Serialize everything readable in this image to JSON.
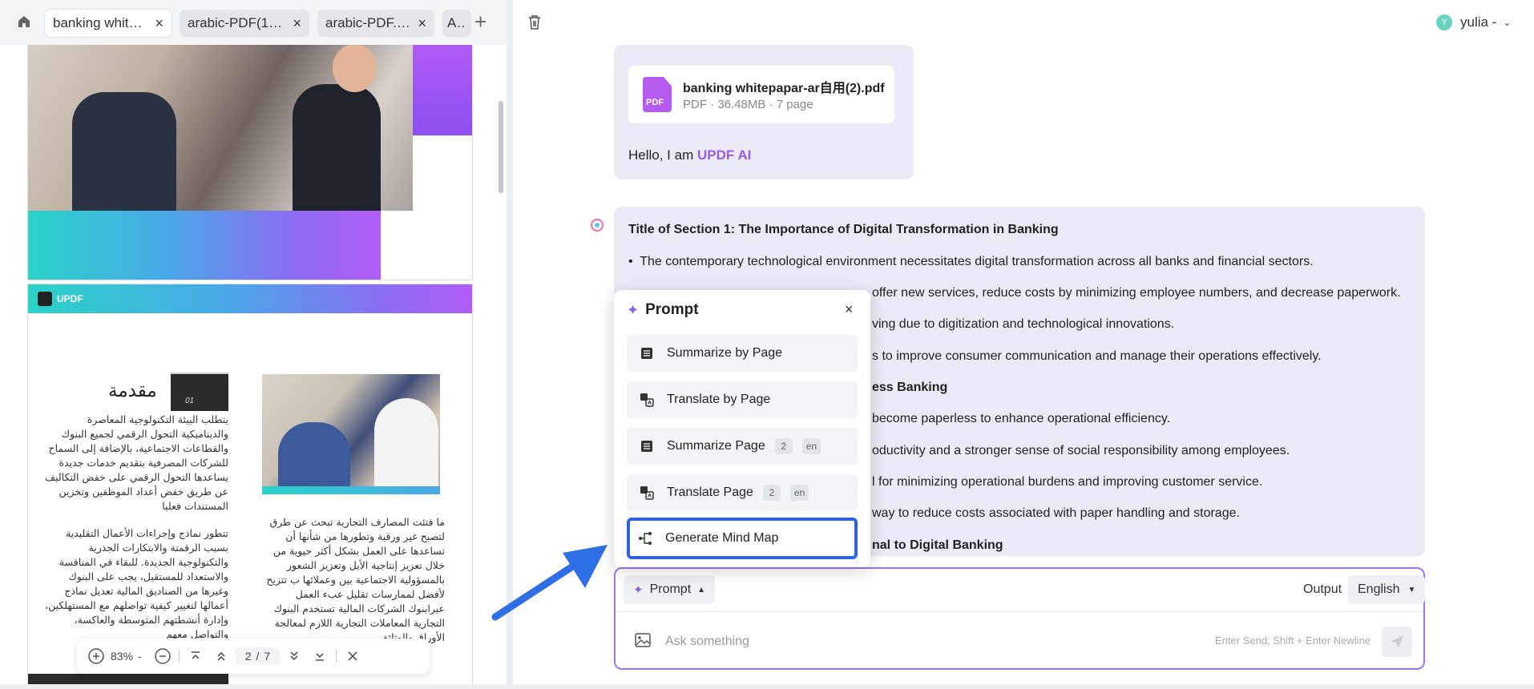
{
  "tabs": [
    {
      "label": "banking whitep...",
      "close": "×"
    },
    {
      "label": "arabic-PDF(1)....",
      "close": "×"
    },
    {
      "label": "arabic-PDF.pdf",
      "close": "×"
    },
    {
      "label": "Ani",
      "close": ""
    }
  ],
  "tabbar": {
    "add_label": "+"
  },
  "pdf": {
    "brand": "UPDF",
    "section_title": "مقدمة",
    "section_number": "01",
    "para1": "يتطلب البيئة التكنولوجية المعاصرة والديناميكية التحول الرقمي لجميع البنوك والقطاعات الاجتماعية، بالإضافة إلى السماح للشركات المصرفية بتقديم خدمات جديدة يساعدها التحول الرقمي على خفض التكاليف عن طريق خفض أعداد الموظفين وتخزين المستندات فعليا",
    "para2": "تتطور نماذج وإجراءات الأعمال التقليدية بسبب الرقمنة والابتكارات الجذرية والتكنولوجية الجديدة. للبقاء في المنافسة والاستعداد للمستقبل، يجب على البنوك وغيرها من الصناديق المالية تعديل نماذج أعمالها لتغيير كيفية تواصلهم مع المستهلكين، وإدارة أنشطتهم المتوسطة والعاكسة، والتواصل معهم",
    "para3": "ما فتئت المصارف التجارية تبحث عن طرق لتصبح غير ورقية وتطورها من شأنها أن تساعدها على العمل بشكل أكثر حيوية من خلال تعزيز إنتاجية الأيل وتعزيز الشعور بالمسؤولية الاجتماعية بين وعملائها ب تتزيح لأفضل لممارسات تقليل عبء العمل عبرابنوك الشركات المالية تستخدم البنوك التجارية المعاملات التجارية اللازم لمعالجة الأوراق والوثائق"
  },
  "page_toolbar": {
    "zoom": "83%",
    "zoom_caret": "-",
    "current_page": "2",
    "page_sep": "/",
    "total_pages": "7"
  },
  "user": {
    "avatar_letter": "Y",
    "name": "yulia -"
  },
  "hello": {
    "file_name": "banking whitepapar-ar自用(2).pdf",
    "file_meta": "PDF · 36.48MB · 7 page",
    "pdf_badge": "PDF",
    "greeting": "Hello, I am ",
    "brand": "UPDF AI"
  },
  "answer": {
    "title": "Title of Section 1: The Importance of Digital Transformation in Banking",
    "lines": [
      "The contemporary technological environment necessitates digital transformation across all banks and financial sectors.",
      "offer new services, reduce costs by minimizing employee numbers, and decrease paperwork.",
      "ving due to digitization and technological innovations.",
      "s to improve consumer communication and manage their operations effectively.",
      "ess Banking",
      "become paperless to enhance operational efficiency.",
      "oductivity and a stronger sense of social responsibility among employees.",
      "l for minimizing operational burdens and improving customer service.",
      "way to reduce costs associated with paper handling and storage.",
      "nal to Digital Banking"
    ]
  },
  "input": {
    "prompt_label": "Prompt",
    "output_label": "Output",
    "language": "English",
    "placeholder": "Ask something",
    "hint": "Enter Send; Shift + Enter Newline"
  },
  "prompt_popup": {
    "title": "Prompt",
    "close": "×",
    "items": [
      {
        "label": "Summarize by Page",
        "icon": "list-icon"
      },
      {
        "label": "Translate by Page",
        "icon": "translate-icon"
      },
      {
        "label": "Summarize Page",
        "icon": "list-icon",
        "page": "2",
        "lang": "en"
      },
      {
        "label": "Translate Page",
        "icon": "translate-icon",
        "page": "2",
        "lang": "en"
      },
      {
        "label": "Generate Mind Map",
        "icon": "mindmap-icon",
        "selected": true
      }
    ]
  },
  "colors": {
    "accent": "#8a62ef",
    "selected_border": "#2f63e0",
    "arrow": "#2f6fe6",
    "input_border": "#9b77ee"
  }
}
